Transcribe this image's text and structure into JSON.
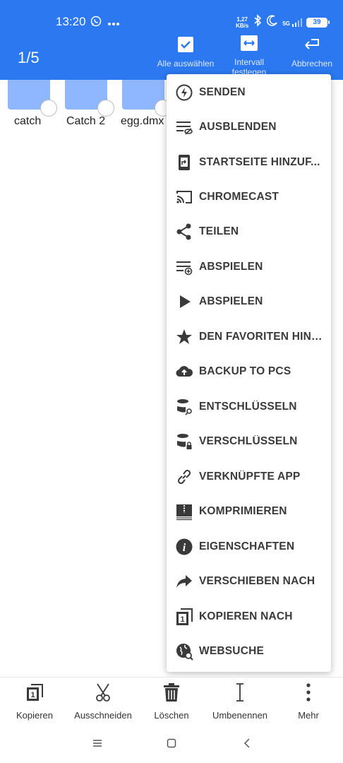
{
  "status": {
    "time": "13:20",
    "net_speed_value": "1,27",
    "net_speed_unit": "KB/s",
    "network": "5G",
    "battery": "39"
  },
  "header": {
    "selection_count": "1/5",
    "actions": [
      {
        "label": "Alle auswählen",
        "icon": "select-all-icon"
      },
      {
        "label": "Intervall festlegen",
        "icon": "interval-icon"
      },
      {
        "label": "Abbrechen",
        "icon": "cancel-icon"
      }
    ],
    "background_color": "#2b78f0"
  },
  "files": [
    {
      "name": "catch"
    },
    {
      "name": "Catch 2"
    },
    {
      "name": "egg.dmx"
    }
  ],
  "menu": {
    "items": [
      {
        "label": "SENDEN",
        "icon": "send-bolt-icon"
      },
      {
        "label": "AUSBLENDEN",
        "icon": "hide-icon"
      },
      {
        "label": "STARTSEITE HINZUF...",
        "icon": "add-to-home-icon"
      },
      {
        "label": "CHROMECAST",
        "icon": "cast-icon"
      },
      {
        "label": "TEILEN",
        "icon": "share-icon"
      },
      {
        "label": "ABSPIELEN",
        "icon": "playlist-add-icon"
      },
      {
        "label": "ABSPIELEN",
        "icon": "play-icon"
      },
      {
        "label": "DEN FAVORITEN HINZ...",
        "icon": "star-icon"
      },
      {
        "label": "BACKUP TO PCS",
        "icon": "cloud-upload-icon"
      },
      {
        "label": "ENTSCHLÜSSELN",
        "icon": "decrypt-icon"
      },
      {
        "label": "VERSCHLÜSSELN",
        "icon": "encrypt-icon"
      },
      {
        "label": "VERKNÜPFTE APP",
        "icon": "link-icon"
      },
      {
        "label": "KOMPRIMIEREN",
        "icon": "compress-icon"
      },
      {
        "label": "EIGENSCHAFTEN",
        "icon": "info-icon"
      },
      {
        "label": "VERSCHIEBEN NACH",
        "icon": "move-icon"
      },
      {
        "label": "KOPIEREN NACH",
        "icon": "copy-to-icon"
      },
      {
        "label": "WEBSUCHE",
        "icon": "web-search-icon"
      }
    ]
  },
  "toolbar": {
    "items": [
      {
        "label": "Kopieren",
        "icon": "copy-icon"
      },
      {
        "label": "Ausschneiden",
        "icon": "scissors-icon"
      },
      {
        "label": "Löschen",
        "icon": "trash-icon"
      },
      {
        "label": "Umbenennen",
        "icon": "rename-icon"
      },
      {
        "label": "Mehr",
        "icon": "more-vertical-icon"
      }
    ]
  },
  "navbar": {
    "icons": [
      "menu-icon",
      "home-square-icon",
      "back-icon"
    ]
  }
}
